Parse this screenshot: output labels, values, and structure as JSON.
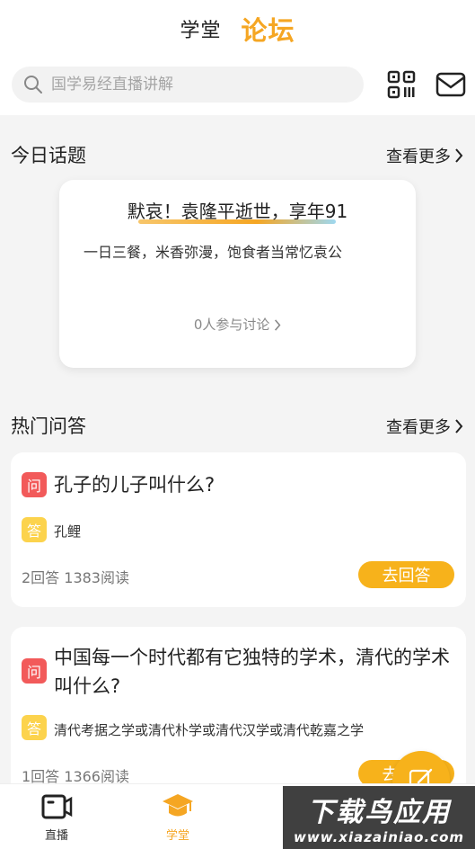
{
  "header": {
    "tabs": [
      {
        "label": "学堂",
        "active": false
      },
      {
        "label": "论坛",
        "active": true
      }
    ],
    "search": {
      "placeholder": "国学易经直播讲解"
    },
    "icons": {
      "qr": "qr-code-icon",
      "mail": "mail-icon"
    }
  },
  "today_topics": {
    "title": "今日话题",
    "more_label": "查看更多",
    "card": {
      "title": "默哀！袁隆平逝世，享年91",
      "desc": "一日三餐，米香弥漫，饱食者当常忆袁公",
      "join": "0人参与讨论"
    }
  },
  "hot_qa": {
    "title": "热门问答",
    "more_label": "查看更多",
    "badge_q": "问",
    "badge_a": "答",
    "answer_label": "去回答",
    "items": [
      {
        "question": "孔子的儿子叫什么?",
        "answer": "孔鲤",
        "stats": "2回答 1383阅读"
      },
      {
        "question": "中国每一个时代都有它独特的学术，清代的学术叫什么?",
        "answer": "清代考据之学或清代朴学或清代汉学或清代乾嘉之学",
        "stats": "1回答 1366阅读"
      }
    ]
  },
  "bottom_nav": {
    "items": [
      {
        "label": "直播",
        "icon": "live-camera-icon",
        "active": false
      },
      {
        "label": "学堂",
        "icon": "graduation-cap-icon",
        "active": true
      }
    ]
  },
  "watermark": {
    "line1": "下载鸟应用",
    "line2": "www.xiazainiao.com"
  },
  "colors": {
    "accent": "#f5a623",
    "question_badge": "#f25a5a",
    "answer_badge": "#fcd34d"
  }
}
